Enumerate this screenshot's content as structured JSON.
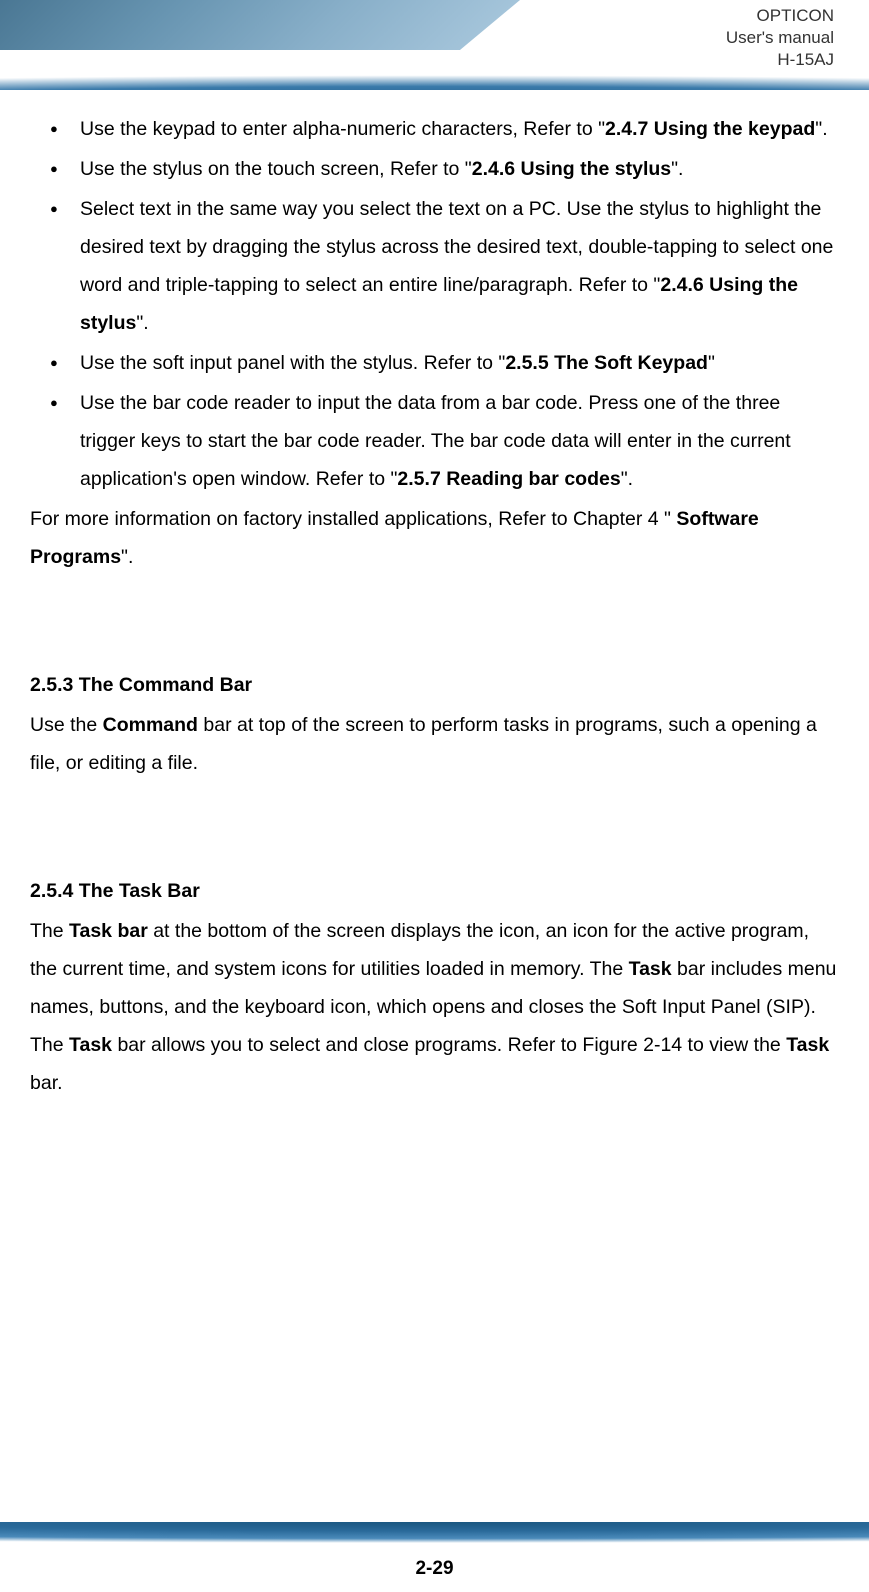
{
  "header": {
    "line1": "OPTICON",
    "line2": "User's manual",
    "line3": "H-15AJ"
  },
  "bullets": [
    {
      "pre": "Use the keypad to enter alpha-numeric characters, Refer to \"",
      "ref": "2.4.7 Using the keypad",
      "post": "\"."
    },
    {
      "pre": "Use the stylus on the touch screen, Refer to \"",
      "ref": "2.4.6 Using the stylus",
      "post": "\"."
    },
    {
      "pre": "Select text in the same way you select the text on a PC. Use the stylus to highlight the desired text by dragging the stylus across the desired text, double-tapping to select one word and triple-tapping to select an entire line/paragraph. Refer to \"",
      "ref": "2.4.6 Using the stylus",
      "post": "\"."
    },
    {
      "pre": "Use the soft input panel with the stylus. Refer to \"",
      "ref": "2.5.5 The Soft Keypad",
      "post": "\""
    },
    {
      "pre": "Use the bar code reader to input the data from a bar code. Press one of the three trigger keys to start the bar code reader. The bar code data will enter in the current application's open window. Refer to \"",
      "ref": "2.5.7 Reading bar codes",
      "post": "\"."
    }
  ],
  "para1": {
    "pre": "For more information on factory installed applications, Refer to Chapter 4 \" ",
    "ref": "Software Programs",
    "post": "\"."
  },
  "section253": {
    "heading": "2.5.3 The Command Bar",
    "body_pre": "Use the ",
    "body_bold": "Command",
    "body_post": " bar at top of the screen to perform tasks in programs, such a opening a file, or editing a file."
  },
  "section254": {
    "heading": "2.5.4 The Task Bar",
    "seg1": "The ",
    "b1": "Task bar",
    "seg2": " at the bottom of the screen displays the icon, an icon for the active program, the current time, and system icons for utilities loaded in memory. The ",
    "b2": "Task",
    "seg3": " bar includes menu names, buttons, and the keyboard icon, which opens and closes the Soft Input Panel (SIP). The ",
    "b3": "Task",
    "seg4": " bar allows you to select and close programs. Refer to Figure 2-14 to view the ",
    "b4": "Task",
    "seg5": " bar."
  },
  "page_number": "2-29"
}
